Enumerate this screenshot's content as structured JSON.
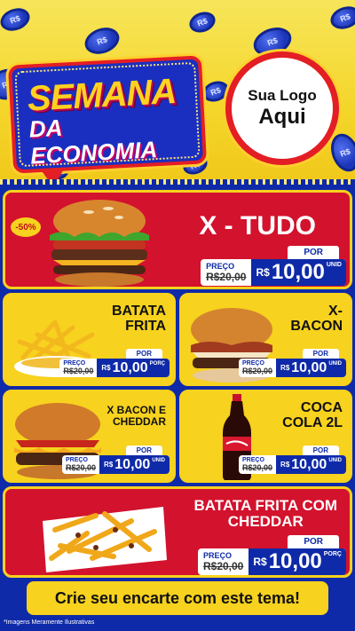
{
  "header": {
    "banner_line1": "SEMANA",
    "banner_line2": "DA ECONOMIA",
    "logo_line1": "Sua Logo",
    "logo_line2": "Aqui",
    "coin_label": "R$"
  },
  "products": [
    {
      "name": "X - TUDO",
      "badge": "-50%",
      "por": "POR",
      "preco_label": "PREÇO",
      "old": "R$20,00",
      "cur": "R$",
      "new": "10,00",
      "unit": "UNID"
    },
    {
      "name_line1": "BATATA",
      "name_line2": "FRITA",
      "por": "POR",
      "preco_label": "PREÇO",
      "old": "R$20,00",
      "cur": "R$",
      "new": "10,00",
      "unit": "PORÇ"
    },
    {
      "name_line1": "X-",
      "name_line2": "BACON",
      "por": "POR",
      "preco_label": "PREÇO",
      "old": "R$20,00",
      "cur": "R$",
      "new": "10,00",
      "unit": "UNID"
    },
    {
      "name_line1": "X BACON E",
      "name_line2": "CHEDDAR",
      "por": "POR",
      "preco_label": "PREÇO",
      "old": "R$20,00",
      "cur": "R$",
      "new": "10,00",
      "unit": "UNID"
    },
    {
      "name_line1": "COCA",
      "name_line2": "COLA 2L",
      "por": "POR",
      "preco_label": "PREÇO",
      "old": "R$20,00",
      "cur": "R$",
      "new": "10,00",
      "unit": "UNID"
    },
    {
      "name_line1": "BATATA FRITA COM",
      "name_line2": "CHEDDAR",
      "por": "POR",
      "preco_label": "PREÇO",
      "old": "R$20,00",
      "cur": "R$",
      "new": "10,00",
      "unit": "PORÇ"
    }
  ],
  "cta": "Crie seu encarte com este tema!",
  "footer": "*Imagens Meramente Ilustrativas",
  "colors": {
    "red": "#d3122d",
    "yellow": "#f7d21e",
    "blue": "#0e2aa8"
  },
  "icons": [
    "coin-icon",
    "burger-icon",
    "fries-icon",
    "bacon-burger-icon",
    "cheddar-burger-icon",
    "soda-bottle-icon",
    "cheddar-fries-icon"
  ]
}
